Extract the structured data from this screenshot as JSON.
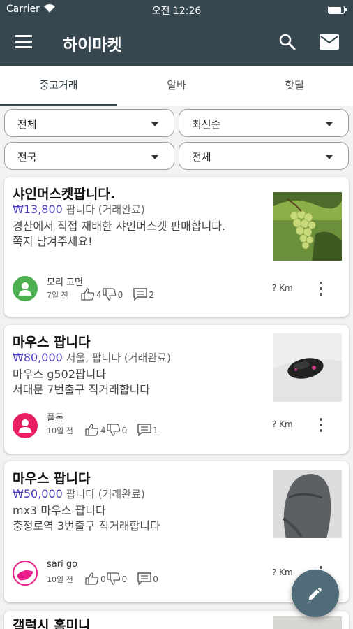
{
  "status_bar": {
    "carrier": "Carrier",
    "time": "오전 12:26",
    "battery_level": 0.9
  },
  "app_bar": {
    "title": "하이마켓"
  },
  "tabs": [
    {
      "label": "중고거래",
      "active": true
    },
    {
      "label": "알바",
      "active": false
    },
    {
      "label": "핫딜",
      "active": false
    }
  ],
  "filters": {
    "category": "전체",
    "sort": "최신순",
    "region": "전국",
    "status": "전체"
  },
  "listings": [
    {
      "title": "샤인머스켓팝니다.",
      "price": "₩13,800",
      "price_note": "팝니다 (거래완료)",
      "description": [
        "경산에서 직접 재배한 샤인머스켓 판매합니다.",
        "쪽지 남겨주세요!"
      ],
      "seller": "모리 고먼",
      "time_ago": "7일 전",
      "likes": "4",
      "dislikes": "0",
      "comments": "2",
      "distance": "? Km",
      "avatar_color": "#4caf50"
    },
    {
      "title": "마우스 팝니다",
      "price": "₩80,000",
      "price_note": "서울, 팝니다 (거래완료)",
      "description": [
        "마우스 g502팝니다",
        "서대문 7번출구 직거래합니다"
      ],
      "seller": "플돈",
      "time_ago": "10일 전",
      "likes": "4",
      "dislikes": "0",
      "comments": "1",
      "distance": "? Km",
      "avatar_color": "#e91e63"
    },
    {
      "title": "마우스 팝니다",
      "price": "₩50,000",
      "price_note": "팝니다 (거래완료)",
      "description": [
        "mx3 마우스 팝니다",
        "충정로역 3번출구 직거래합니다"
      ],
      "seller": "sari go",
      "time_ago": "10일 전",
      "likes": "0",
      "dislikes": "0",
      "comments": "0",
      "distance": "? Km",
      "avatar_color": "#e91e8c"
    },
    {
      "title": "갤럭시 홈미니"
    }
  ],
  "colors": {
    "primary": "#37474f",
    "price": "#4a3fb8",
    "fab": "#4f6c78"
  }
}
